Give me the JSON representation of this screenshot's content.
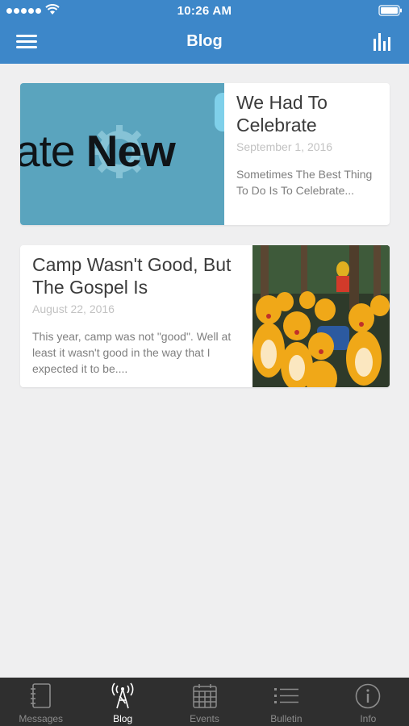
{
  "status_bar": {
    "time": "10:26 AM"
  },
  "nav": {
    "title": "Blog",
    "menu_icon": "hamburger-menu-icon",
    "right_icon": "bar-chart-icon"
  },
  "posts": [
    {
      "title": "We Had To Celebrate",
      "date": "September 1, 2016",
      "excerpt": "Sometimes The Best Thing To Do Is To Celebrate...",
      "image_text": "New",
      "image_text_prefix": "ate"
    },
    {
      "title": "Camp Wasn't Good, But The Gospel Is",
      "date": "August 22, 2016",
      "excerpt": "This year, camp was not \"good\". Well at least it wasn't good in the way that I expected it to be...."
    }
  ],
  "tabs": [
    {
      "label": "Messages",
      "icon": "notebook-icon",
      "active": false
    },
    {
      "label": "Blog",
      "icon": "broadcast-tower-icon",
      "active": true
    },
    {
      "label": "Events",
      "icon": "calendar-icon",
      "active": false
    },
    {
      "label": "Bulletin",
      "icon": "list-icon",
      "active": false
    },
    {
      "label": "Info",
      "icon": "info-icon",
      "active": false
    }
  ],
  "colors": {
    "nav": "#3d87c9",
    "tabbar": "#2f2f2f",
    "background": "#efeff0",
    "thumb1": "#5aa4be"
  }
}
